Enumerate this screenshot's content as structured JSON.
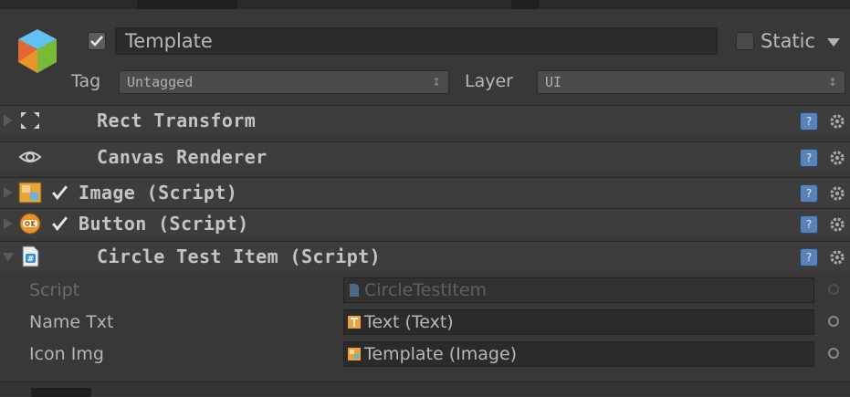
{
  "header": {
    "enabled": true,
    "name": "Template",
    "static_label": "Static",
    "static_checked": false,
    "tag_label": "Tag",
    "tag_value": "Untagged",
    "layer_label": "Layer",
    "layer_value": "UI",
    "popup_arrows": "↕"
  },
  "components": [
    {
      "title": "Rect Transform",
      "icon": "rect-transform-icon",
      "has_checkbox": false,
      "expanded": false
    },
    {
      "title": "Canvas Renderer",
      "icon": "eye-icon",
      "has_checkbox": false,
      "expanded": false
    },
    {
      "title": "Image (Script)",
      "icon": "image-icon",
      "has_checkbox": true,
      "checked": true,
      "expanded": false
    },
    {
      "title": "Button (Script)",
      "icon": "button-ok-icon",
      "has_checkbox": true,
      "checked": true,
      "expanded": false
    },
    {
      "title": "Circle Test Item (Script)",
      "icon": "csharp-script-icon",
      "has_checkbox": false,
      "expanded": true
    }
  ],
  "fields": [
    {
      "label": "Script",
      "value": "CircleTestItem",
      "disabled": true,
      "icon": "script-asset-icon"
    },
    {
      "label": "Name Txt",
      "value": "Text (Text)",
      "disabled": false,
      "icon": "text-component-icon"
    },
    {
      "label": "Icon Img",
      "value": "Template (Image)",
      "disabled": false,
      "icon": "image-component-icon"
    }
  ],
  "help_glyph": "?",
  "colors": {
    "background": "#383838",
    "component_header": "#3d3d3d",
    "field_bg": "#2b2b2b",
    "help_blue": "#5882b8"
  }
}
